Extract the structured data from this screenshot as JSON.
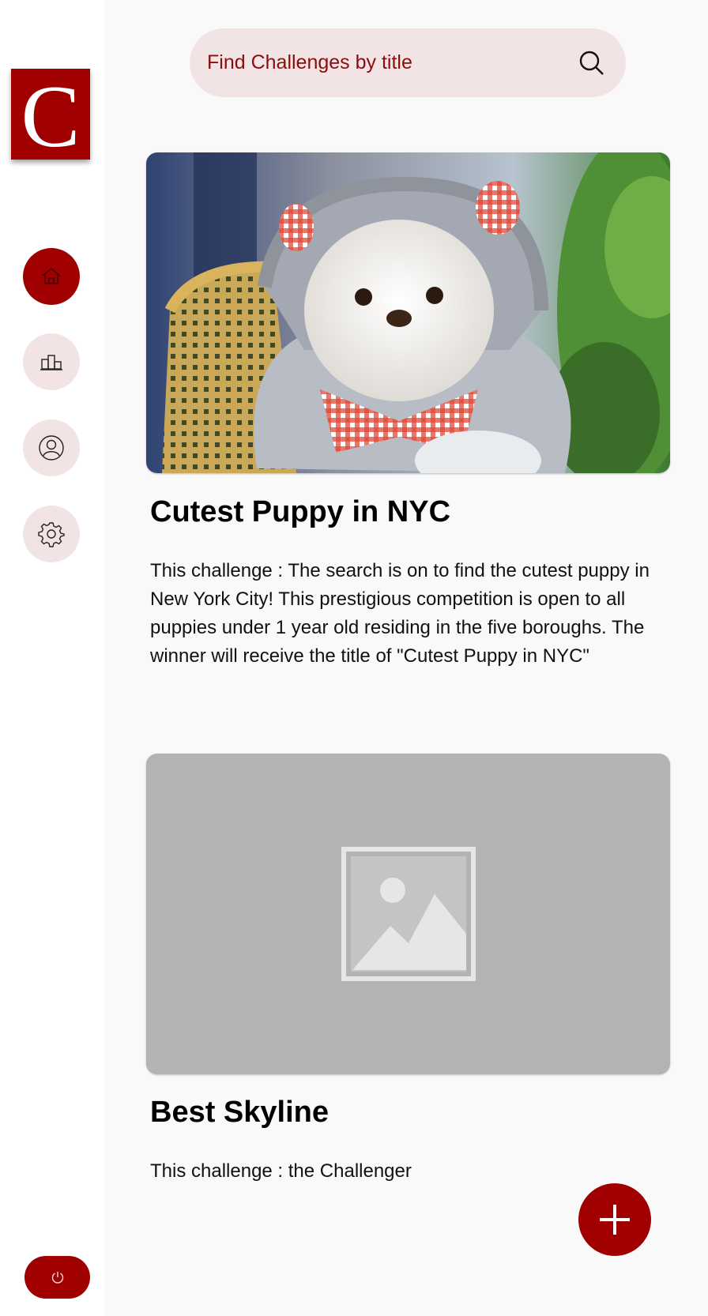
{
  "app": {
    "logo_letter": "C",
    "brand_color": "#a10000",
    "pill_color": "#f2e4e4"
  },
  "sidebar": {
    "items": [
      {
        "name": "home",
        "icon": "home-icon",
        "active": true
      },
      {
        "name": "leaderboard",
        "icon": "podium-icon",
        "active": false
      },
      {
        "name": "profile",
        "icon": "user-icon",
        "active": false
      },
      {
        "name": "settings",
        "icon": "gear-icon",
        "active": false
      }
    ],
    "logout_icon": "power-icon"
  },
  "search": {
    "placeholder": "Find Challenges by title",
    "value": "",
    "icon": "search-icon"
  },
  "challenges": [
    {
      "title": "Cutest Puppy in NYC",
      "description": "This challenge : The search is on to find the cutest puppy in New York City! This prestigious competition is open to all puppies under 1 year old residing in the five boroughs. The winner will receive the title of \"Cutest Puppy in NYC\"",
      "image": "puppy-photo"
    },
    {
      "title": "Best Skyline",
      "description": "This challenge : the Challenger",
      "image": "image-placeholder-icon"
    }
  ],
  "fab": {
    "icon": "plus-icon"
  }
}
